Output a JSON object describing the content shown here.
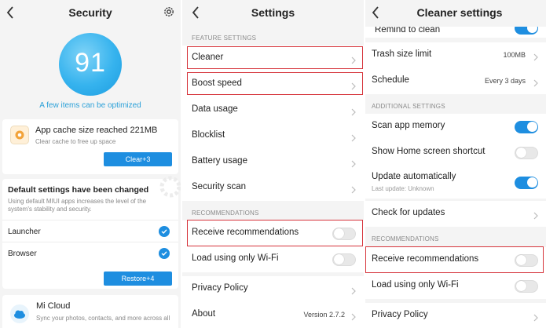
{
  "panel1": {
    "title": "Security",
    "score": "91",
    "optimize_text": "A few items can be optimized",
    "cache_card": {
      "title": "App cache size reached 221MB",
      "subtitle": "Clear cache to free up space",
      "button": "Clear+3"
    },
    "default_card": {
      "title": "Default settings have been changed",
      "subtitle": "Using default MIUI apps increases the level of the system's stability and security.",
      "items": [
        "Launcher",
        "Browser"
      ],
      "button": "Restore+4"
    },
    "micloud_card": {
      "title": "Mi Cloud",
      "subtitle": "Sync your photos, contacts, and more across all"
    }
  },
  "panel2": {
    "title": "Settings",
    "feature_section": "FEATURE SETTINGS",
    "feature_items": [
      "Cleaner",
      "Boost speed",
      "Data usage",
      "Blocklist",
      "Battery usage",
      "Security scan"
    ],
    "recommend_section": "RECOMMENDATIONS",
    "receive_recommendations": "Receive recommendations",
    "load_wifi": "Load using only Wi-Fi",
    "privacy_policy": "Privacy Policy",
    "about": "About",
    "version": "Version 2.7.2"
  },
  "panel3": {
    "title": "Cleaner settings",
    "remind_to_clean": "Remind to clean",
    "trash_size_limit": "Trash size limit",
    "trash_size_value": "100MB",
    "schedule": "Schedule",
    "schedule_value": "Every 3 days",
    "additional_section": "ADDITIONAL SETTINGS",
    "scan_app_memory": "Scan app memory",
    "show_shortcut": "Show Home screen shortcut",
    "update_auto": "Update automatically",
    "last_update": "Last update: Unknown",
    "check_updates": "Check for updates",
    "recommend_section": "RECOMMENDATIONS",
    "receive_recommendations": "Receive recommendations",
    "load_wifi": "Load using only Wi-Fi",
    "privacy_policy": "Privacy Policy"
  },
  "colors": {
    "accent": "#1e8ee0",
    "highlight": "#d6343b",
    "score_blue": "#36b3ee"
  },
  "icons": [
    "back-arrow-icon",
    "gear-icon",
    "chevron-right-icon",
    "check-icon",
    "app-cache-icon",
    "cloud-icon"
  ],
  "toggles": {
    "p2_receive_recommendations": "off",
    "p2_load_wifi": "off",
    "p3_remind_to_clean": "on",
    "p3_scan_app_memory": "on",
    "p3_show_shortcut": "off",
    "p3_update_auto": "on",
    "p3_receive_recommendations": "off",
    "p3_load_wifi": "off"
  }
}
